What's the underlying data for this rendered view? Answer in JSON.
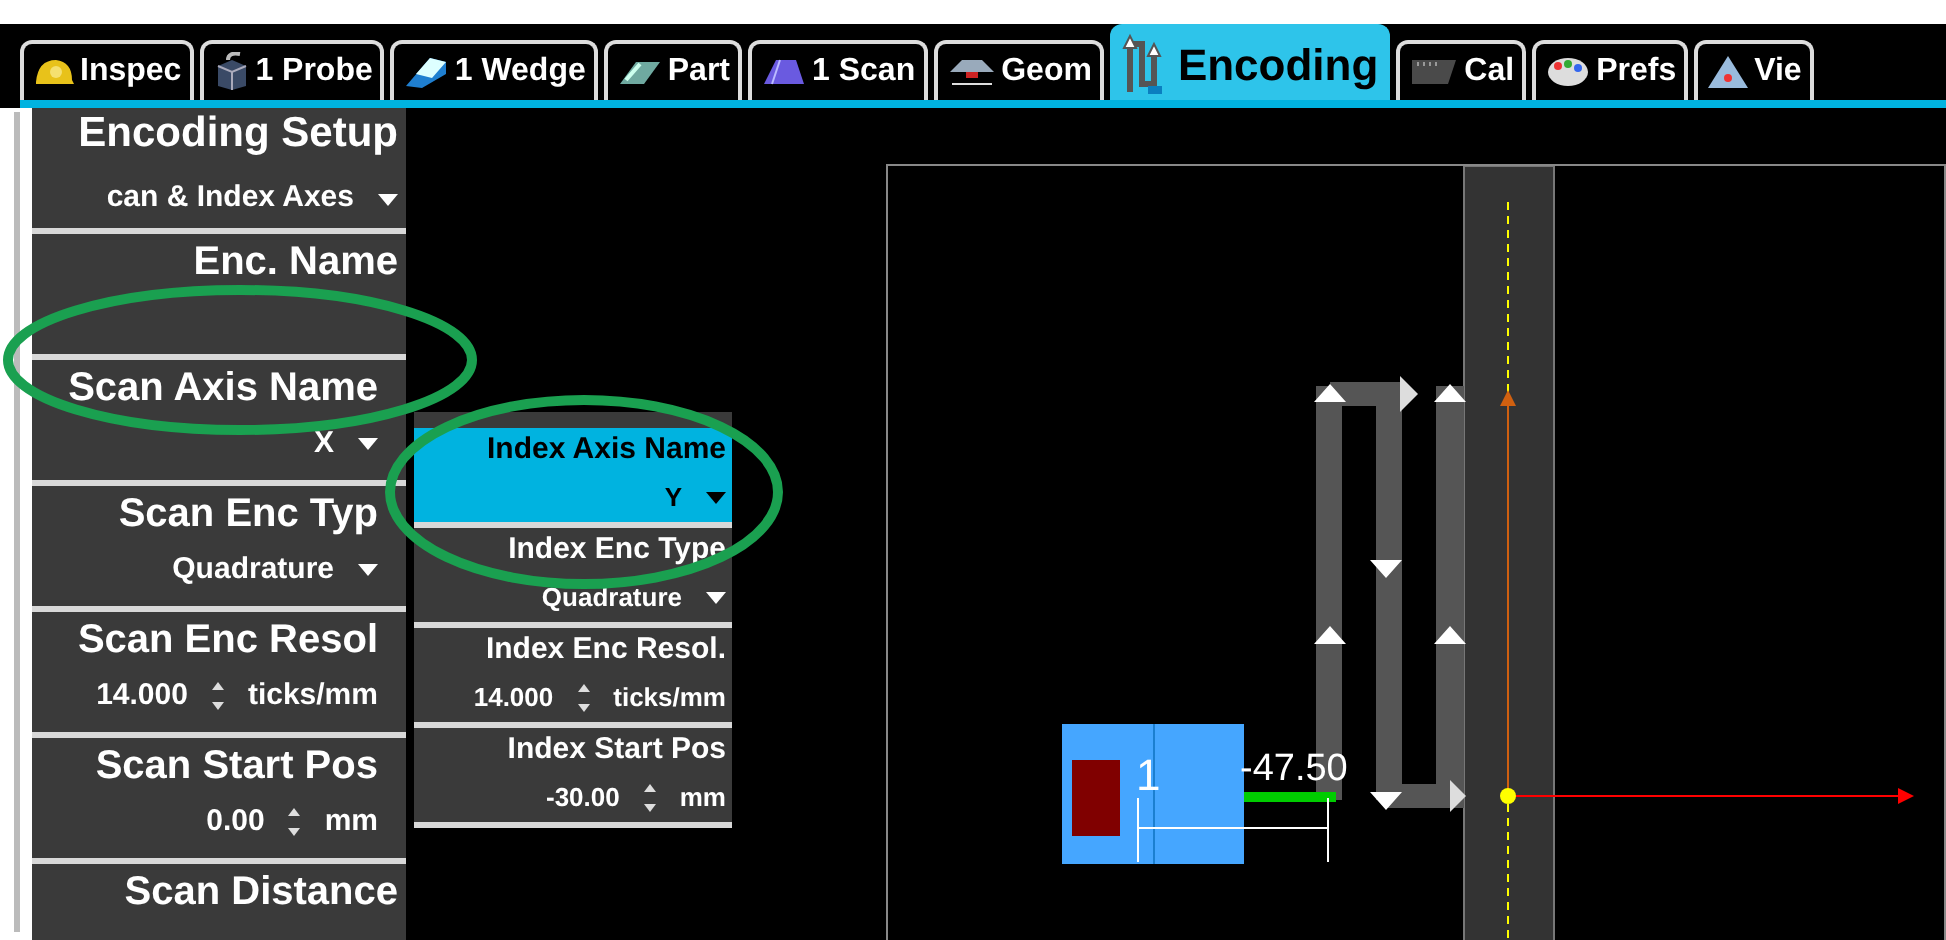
{
  "tabs": [
    {
      "label": "Inspec",
      "selected": false
    },
    {
      "label": "1 Probe",
      "selected": false
    },
    {
      "label": "1 Wedge",
      "selected": false
    },
    {
      "label": "Part",
      "selected": false
    },
    {
      "label": "1 Scan",
      "selected": false
    },
    {
      "label": "Geom",
      "selected": false
    },
    {
      "label": "Encoding",
      "selected": true
    },
    {
      "label": "Cal",
      "selected": false
    },
    {
      "label": "Prefs",
      "selected": false
    },
    {
      "label": "Vie",
      "selected": false
    }
  ],
  "left_panel": {
    "title": "Encoding Setup",
    "mode": "can & Index Axes",
    "items": [
      {
        "kind": "text",
        "label": "Enc. Name"
      },
      {
        "kind": "dropdown",
        "label": "Scan Axis Name",
        "value": "X"
      },
      {
        "kind": "dropdown",
        "label": "Scan Enc Typ",
        "value": "Quadrature"
      },
      {
        "kind": "spinner",
        "label": "Scan Enc Resol",
        "value": "14.000",
        "unit": "ticks/mm"
      },
      {
        "kind": "spinner",
        "label": "Scan Start Pos",
        "value": "0.00",
        "unit": "mm"
      },
      {
        "kind": "label",
        "label": "Scan Distance"
      }
    ]
  },
  "popup": {
    "items": [
      {
        "kind": "dropdown",
        "label": "Index Axis Name",
        "value": "Y",
        "selected": true
      },
      {
        "kind": "dropdown",
        "label": "Index Enc Type",
        "value": "Quadrature",
        "selected": false
      },
      {
        "kind": "spinner",
        "label": "Index Enc Resol.",
        "value": "14.000",
        "unit": "ticks/mm",
        "selected": false
      },
      {
        "kind": "spinner",
        "label": "Index Start Pos",
        "value": "-30.00",
        "unit": "mm",
        "selected": false
      }
    ]
  },
  "canvas": {
    "probe_label": "1",
    "offset_label": "-47.50"
  }
}
